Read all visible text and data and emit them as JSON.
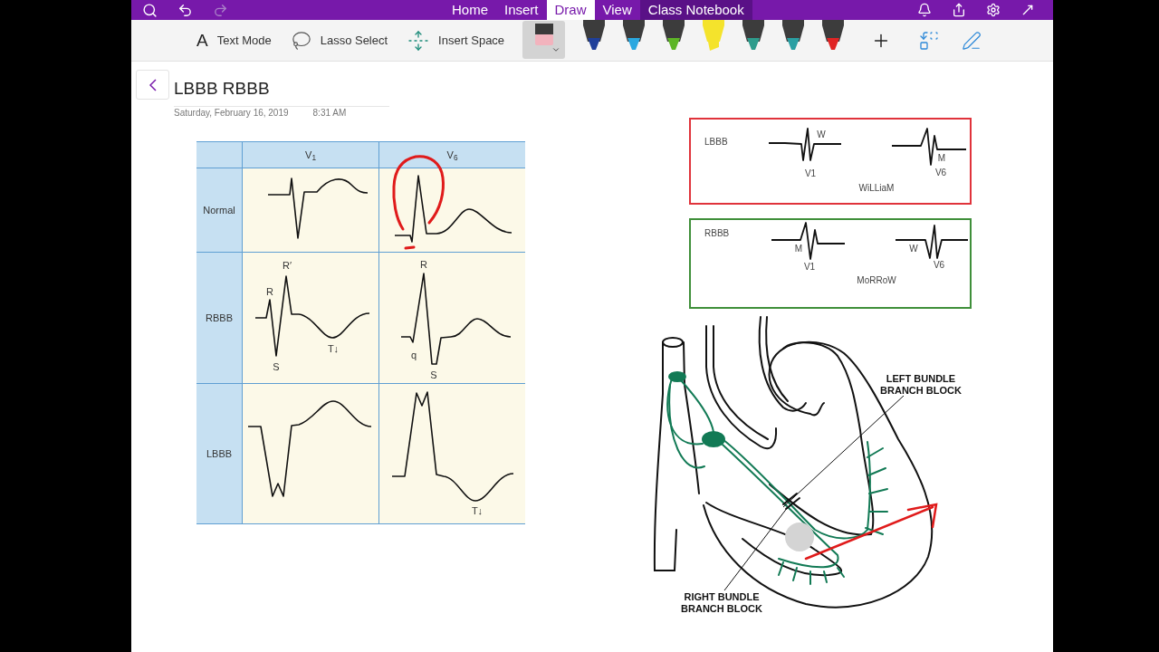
{
  "ribbon_tabs": [
    {
      "label": "Home",
      "selected": false,
      "kind": "tab"
    },
    {
      "label": "Insert",
      "selected": false,
      "kind": "tab"
    },
    {
      "label": "Draw",
      "selected": true,
      "kind": "tab"
    },
    {
      "label": "View",
      "selected": false,
      "kind": "tab"
    },
    {
      "label": "Class Notebook",
      "selected": false,
      "kind": "addin"
    }
  ],
  "draw_tools": [
    {
      "label": "Text Mode",
      "kind": "text",
      "icon_text": "A"
    },
    {
      "label": "Lasso Select",
      "kind": "lasso"
    },
    {
      "label": "Insert Space",
      "kind": "space"
    }
  ],
  "pens": [
    {
      "kind": "pen",
      "color": "#1f3f9a"
    },
    {
      "kind": "pen",
      "color": "#2aa8e0"
    },
    {
      "kind": "pen",
      "color": "#5db526"
    },
    {
      "kind": "highlighter",
      "color": "#f4e32c"
    },
    {
      "kind": "pen",
      "color": "#2e9c8c"
    },
    {
      "kind": "pen",
      "color": "#2a9fa3"
    },
    {
      "kind": "pen",
      "color": "#e02424"
    }
  ],
  "page": {
    "title": "LBBB RBBB",
    "date": "Saturday, February 16, 2019",
    "time": "8:31 AM"
  },
  "ecg_table": {
    "columns": [
      "V$_{1}$",
      "V$_{6}$"
    ],
    "rows": [
      {
        "label": "Normal",
        "cells": [
          {},
          {}
        ]
      },
      {
        "label": "RBBB",
        "cells": [
          {
            "annotations": [
              "R",
              "R′",
              "S",
              "T↓"
            ]
          },
          {
            "annotations": [
              "R",
              "q",
              "S"
            ]
          }
        ]
      },
      {
        "label": "LBBB",
        "cells": [
          {},
          {
            "annotations": [
              "T↓"
            ]
          }
        ]
      }
    ]
  },
  "mnemonic_boxes": [
    {
      "label": "LBBB",
      "color": "#e0333b",
      "leads": [
        {
          "letter": "W",
          "lead": "V1"
        },
        {
          "letter": "M",
          "lead": "V6"
        }
      ],
      "mnemonic": "WiLLiaM"
    },
    {
      "label": "RBBB",
      "color": "#3f8f3a",
      "leads": [
        {
          "letter": "M",
          "lead": "V1"
        },
        {
          "letter": "W",
          "lead": "V6"
        }
      ],
      "mnemonic": "MoRRoW"
    }
  ],
  "heart_diagram": {
    "labels": [
      "LEFT BUNDLE BRANCH BLOCK",
      "RIGHT BUNDLE BRANCH BLOCK"
    ]
  }
}
